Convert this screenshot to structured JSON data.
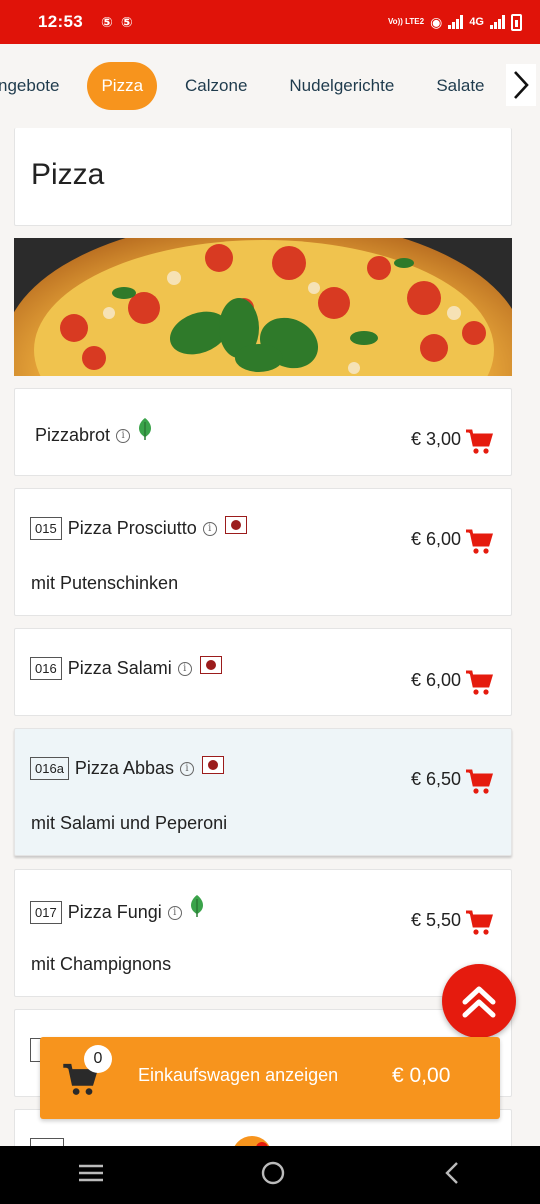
{
  "status_bar": {
    "time": "12:53",
    "network_volte": "Vo)) LTE2",
    "network_type": "4G"
  },
  "tabs": [
    {
      "label": "ngebote",
      "active": false
    },
    {
      "label": "Pizza",
      "active": true
    },
    {
      "label": "Calzone",
      "active": false
    },
    {
      "label": "Nudelgerichte",
      "active": false
    },
    {
      "label": "Salate",
      "active": false
    }
  ],
  "section": {
    "title": "Pizza"
  },
  "items": [
    {
      "number": "",
      "name": "Pizzabrot",
      "badge": "leaf-icon",
      "description": "",
      "price": "€ 3,00"
    },
    {
      "number": "015",
      "name": "Pizza Prosciutto",
      "badge": "meat-icon",
      "description": "mit Putenschinken",
      "price": "€ 6,00"
    },
    {
      "number": "016",
      "name": "Pizza Salami",
      "badge": "meat-icon",
      "description": "",
      "price": "€ 6,00"
    },
    {
      "number": "016a",
      "name": "Pizza Abbas",
      "badge": "meat-icon",
      "description": "mit Salami und Peperoni",
      "price": "€ 6,50"
    },
    {
      "number": "017",
      "name": "Pizza Fungi",
      "badge": "leaf-icon",
      "description": "mit Champignons",
      "price": "€ 5,50"
    }
  ],
  "cart": {
    "count": "0",
    "label": "Einkaufswagen anzeigen",
    "total": "€ 0,00"
  },
  "colors": {
    "accent": "#f7941d",
    "brand_red": "#e01309",
    "cart_icon_red": "#e51b0e"
  }
}
